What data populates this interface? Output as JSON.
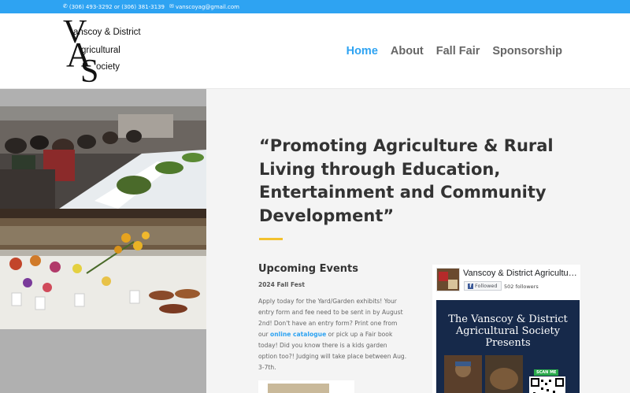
{
  "topbar": {
    "phone": "(306) 493-3292 or (306) 381-3139",
    "email": "vanscoyag@gmail.com"
  },
  "logo": {
    "big_v": "V",
    "big_a": "A",
    "big_s": "S",
    "line1": "anscoy & District",
    "line2": "gricultural",
    "line3": "ociety"
  },
  "nav": {
    "items": [
      {
        "label": "Home",
        "active": true
      },
      {
        "label": "About"
      },
      {
        "label": "Fall Fair"
      },
      {
        "label": "Sponsorship"
      }
    ]
  },
  "hero": {
    "quote": "“Promoting Agriculture & Rural Living through Education, Entertainment and Community Development”"
  },
  "events": {
    "title": "Upcoming Events",
    "subtitle": "2024 Fall Fest",
    "body_1": "Apply today for the Yard/Garden exhibits! Your entry form and fee need to be sent in by August 2nd! Don't have an entry form? Print one from our ",
    "link": "online catalogue",
    "body_2": " or pick up a Fair book today! Did you know there is a kids garden option too?! Judging will take place between Aug. 3-7th."
  },
  "facebook": {
    "page_name": "Vanscoy & District Agricultural Society",
    "followed_label": "Followed",
    "followers": "502 followers",
    "cover_title": "The Vanscoy & District Agricultural Society Presents",
    "scan_label": "SCAN ME"
  },
  "colors": {
    "accent": "#2ea3f2",
    "divider": "#f2c12e"
  }
}
